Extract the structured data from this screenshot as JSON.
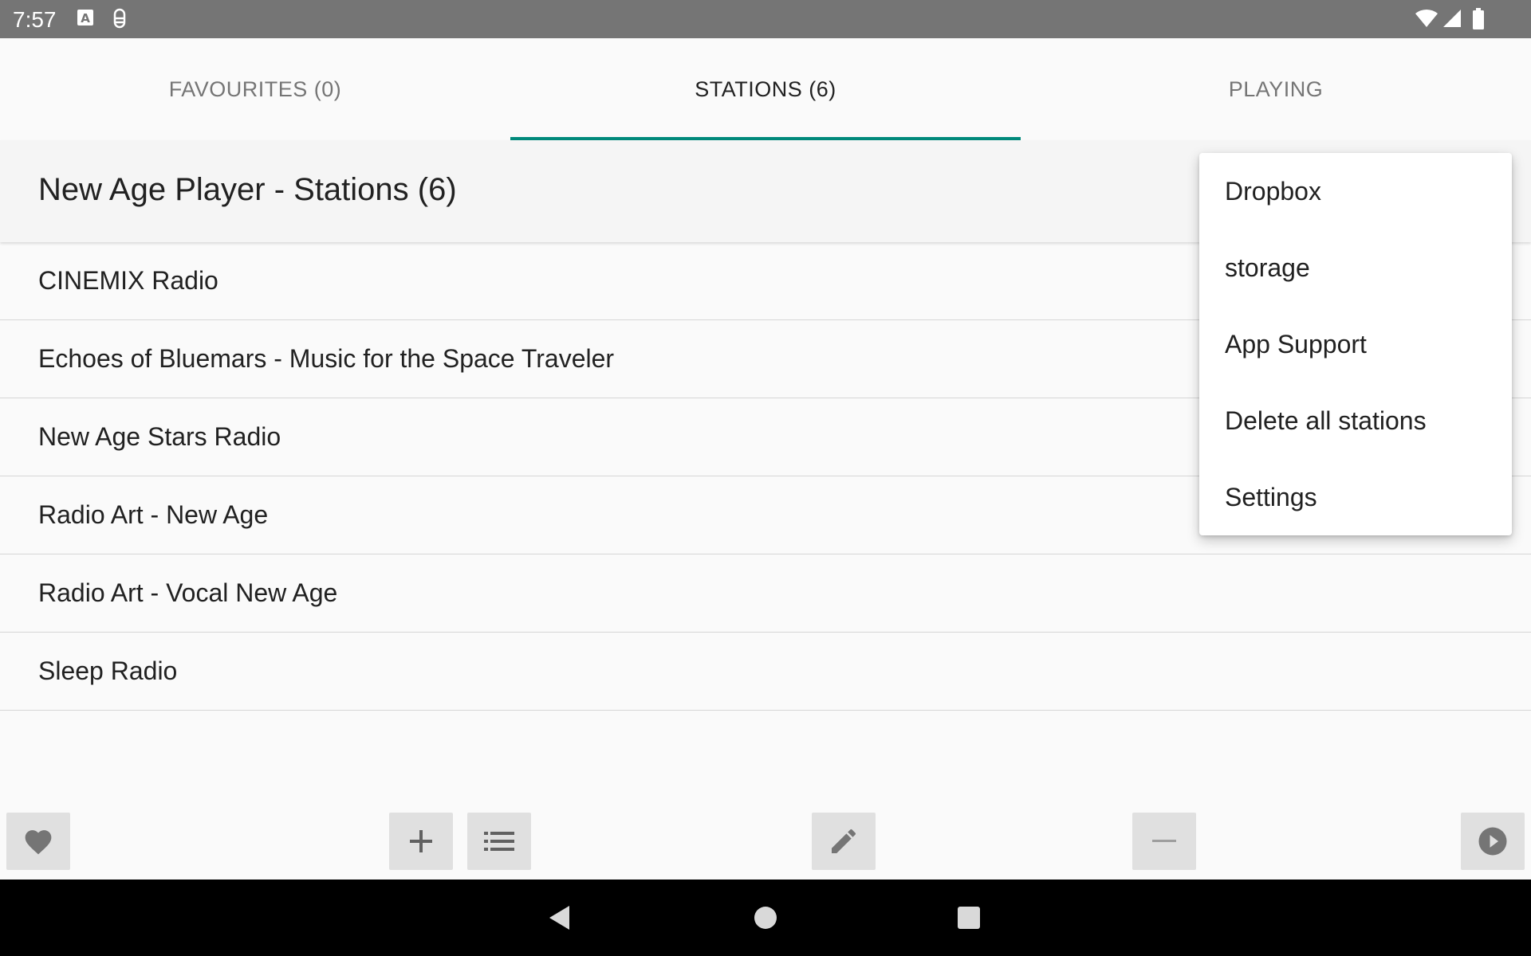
{
  "status_bar": {
    "time": "7:57",
    "icons": [
      "keyboard-a-icon",
      "android-debug-icon",
      "wifi-icon",
      "signal-icon",
      "battery-icon"
    ]
  },
  "tabs": [
    {
      "label": "FAVOURITES (0)",
      "active": false
    },
    {
      "label": "STATIONS (6)",
      "active": true
    },
    {
      "label": "PLAYING",
      "active": false
    }
  ],
  "header": {
    "title": "New Age Player - Stations (6)"
  },
  "stations": [
    "CINEMIX Radio",
    "Echoes of Bluemars - Music for the Space Traveler",
    "New Age Stars Radio",
    "Radio Art - New Age",
    "Radio Art - Vocal New Age",
    "Sleep Radio"
  ],
  "overflow_menu": {
    "items": [
      "Dropbox",
      "storage",
      "App Support",
      "Delete all stations",
      "Settings"
    ]
  },
  "toolbar": {
    "buttons": [
      "heart-icon",
      "plus-icon",
      "list-icon",
      "pencil-icon",
      "minus-icon",
      "play-circle-icon"
    ]
  },
  "colors": {
    "accent": "#00897b",
    "status_bar": "#757575",
    "nav_bar": "#000000"
  }
}
